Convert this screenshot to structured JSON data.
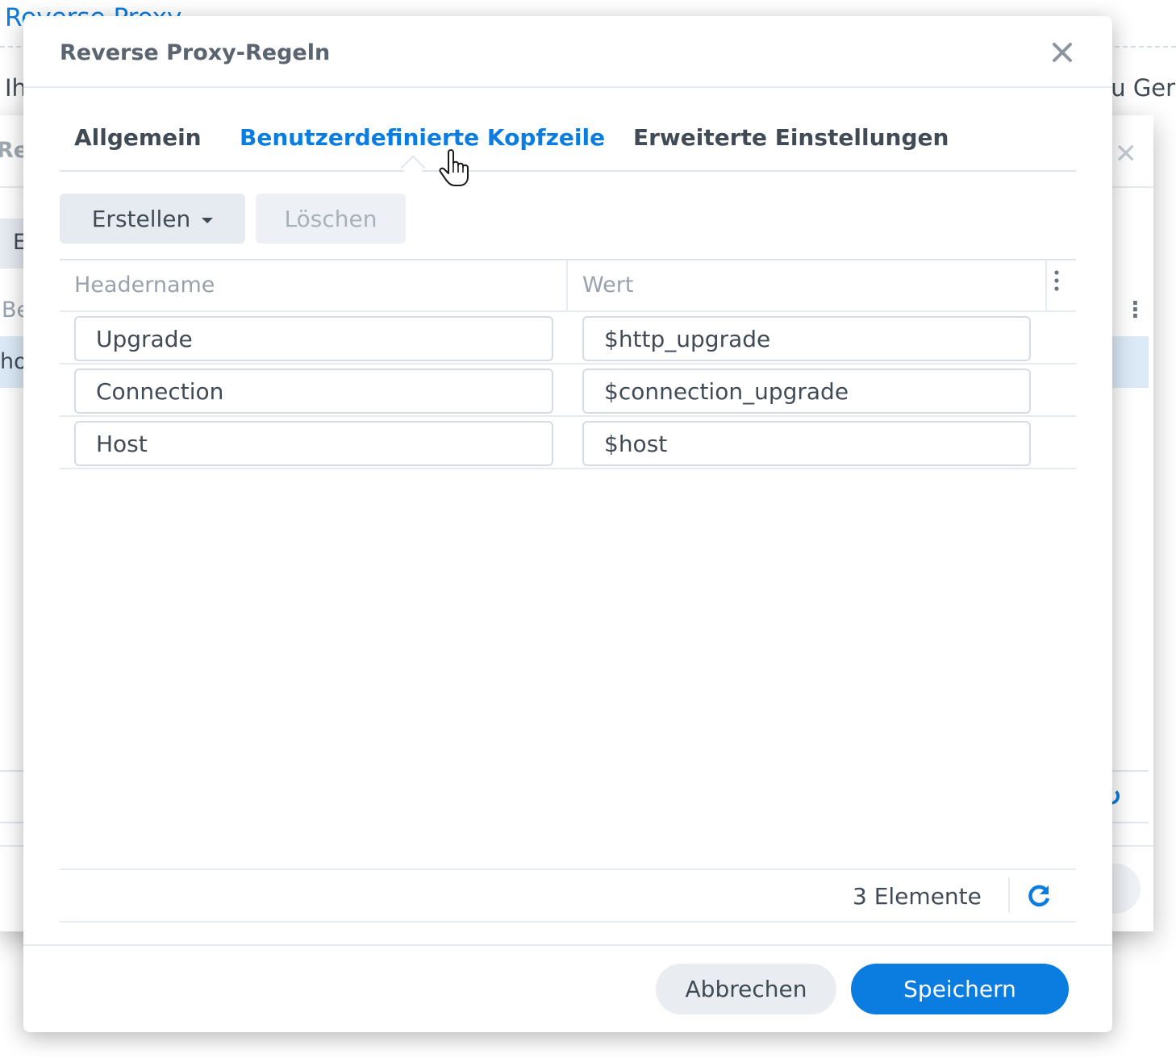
{
  "background": {
    "app_title": "Reverse Proxy",
    "intro_text_left": "Ih",
    "intro_text_right": "zu Ger",
    "window_title": "Rev",
    "button_label": "E",
    "column_header": "Be",
    "row_text": "ho"
  },
  "dialog": {
    "title": "Reverse Proxy-Regeln",
    "tabs": [
      {
        "label": "Allgemein",
        "active": false
      },
      {
        "label": "Benutzerdefinierte Kopfzeile",
        "active": true
      },
      {
        "label": "Erweiterte Einstellungen",
        "active": false
      }
    ],
    "toolbar": {
      "create_label": "Erstellen",
      "delete_label": "Löschen",
      "delete_disabled": true
    },
    "grid": {
      "columns": [
        "Headername",
        "Wert"
      ],
      "rows": [
        {
          "name": "Upgrade",
          "value": "$http_upgrade"
        },
        {
          "name": "Connection",
          "value": "$connection_upgrade"
        },
        {
          "name": "Host",
          "value": "$host"
        }
      ]
    },
    "footer": {
      "count_text": "3 Elemente"
    },
    "buttons": {
      "cancel_label": "Abbrechen",
      "save_label": "Speichern"
    }
  },
  "colors": {
    "accent": "#0b7ce0",
    "text": "#414b55",
    "muted": "#98a2ad"
  },
  "icons": {
    "close": "close-icon",
    "dropdown": "chevron-down-icon",
    "column_menu": "more-vertical-icon",
    "refresh": "refresh-icon",
    "cursor": "hand-pointer-icon"
  }
}
